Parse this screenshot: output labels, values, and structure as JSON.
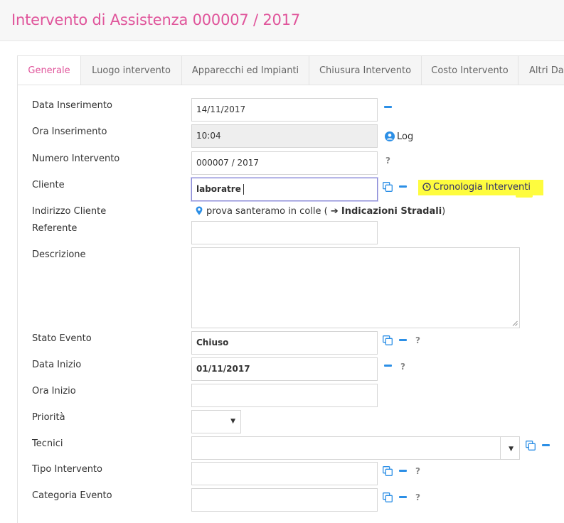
{
  "header": {
    "title": "Intervento di Assistenza 000007 / 2017"
  },
  "tabs": [
    {
      "label": "Generale"
    },
    {
      "label": "Luogo intervento"
    },
    {
      "label": "Apparecchi ed Impianti"
    },
    {
      "label": "Chiusura Intervento"
    },
    {
      "label": "Costo Intervento"
    },
    {
      "label": "Altri Dati"
    }
  ],
  "form": {
    "data_inserimento": {
      "label": "Data Inserimento",
      "value": "14/11/2017"
    },
    "ora_inserimento": {
      "label": "Ora Inserimento",
      "value": "10:04",
      "log_label": "Log"
    },
    "numero_intervento": {
      "label": "Numero Intervento",
      "value": "000007 / 2017",
      "help": "?"
    },
    "cliente": {
      "label": "Cliente",
      "value": "laboratre",
      "history_label": "Cronologia Interventi"
    },
    "indirizzo_cliente": {
      "label": "Indirizzo Cliente",
      "address": "prova santeramo in colle (",
      "arrow": "➔",
      "directions": "Indicazioni Stradali",
      "close_paren": ")"
    },
    "referente": {
      "label": "Referente",
      "value": ""
    },
    "descrizione": {
      "label": "Descrizione",
      "value": ""
    },
    "stato_evento": {
      "label": "Stato Evento",
      "value": "Chiuso",
      "help": "?"
    },
    "data_inizio": {
      "label": "Data Inizio",
      "value": "01/11/2017",
      "help": "?"
    },
    "ora_inizio": {
      "label": "Ora Inizio",
      "value": ""
    },
    "priorita": {
      "label": "Priorità",
      "value": ""
    },
    "tecnici": {
      "label": "Tecnici",
      "value": ""
    },
    "tipo_intervento": {
      "label": "Tipo Intervento",
      "value": "",
      "help": "?"
    },
    "categoria_evento": {
      "label": "Categoria Evento",
      "value": "",
      "help": "?"
    }
  },
  "colors": {
    "accent_pink": "#e0559b",
    "action_blue": "#2c8fe6",
    "highlight_yellow": "#fefc3e"
  }
}
